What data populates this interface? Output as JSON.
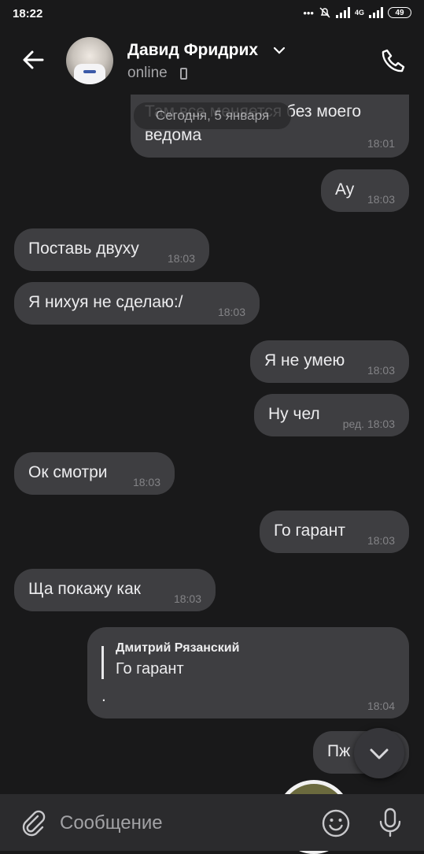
{
  "status_bar": {
    "time": "18:22",
    "network": "4G",
    "battery": "49"
  },
  "header": {
    "contact_name": "Давид Фридрих",
    "contact_status": "online"
  },
  "date_divider": "Сегодня, 5 января",
  "messages": [
    {
      "side": "out",
      "text": "Там все меняется без моего",
      "text2": "ведома",
      "time": "18:01"
    },
    {
      "side": "out",
      "text": "Ау",
      "time": "18:03"
    },
    {
      "side": "in",
      "text": "Поставь двуху",
      "time": "18:03"
    },
    {
      "side": "in",
      "text": "Я нихуя не сделаю:/",
      "time": "18:03"
    },
    {
      "side": "out",
      "text": "Я не умею",
      "time": "18:03"
    },
    {
      "side": "out",
      "text": "Ну чел",
      "time": "ред. 18:03"
    },
    {
      "side": "in",
      "text": "Ок смотри",
      "time": "18:03"
    },
    {
      "side": "out",
      "text": "Го гарант",
      "time": "18:03"
    },
    {
      "side": "in",
      "text": "Ща покажу как",
      "time": "18:03"
    },
    {
      "side": "out",
      "reply_author": "Дмитрий Рязанский",
      "reply_text": "Го гарант",
      "text": ".",
      "time": "18:04"
    },
    {
      "side": "out",
      "text": "Пж",
      "time": ""
    }
  ],
  "composer": {
    "placeholder": "Сообщение"
  },
  "icons": {
    "back": "arrow-left-icon",
    "call": "phone-icon",
    "attach": "paperclip-icon",
    "emoji": "smiley-icon",
    "mic": "microphone-icon",
    "scroll": "chevron-down-icon"
  },
  "colors": {
    "background": "#19191a",
    "bubble": "#3e3e41",
    "composer": "#2b2b2d",
    "timestamp": "#838386"
  }
}
